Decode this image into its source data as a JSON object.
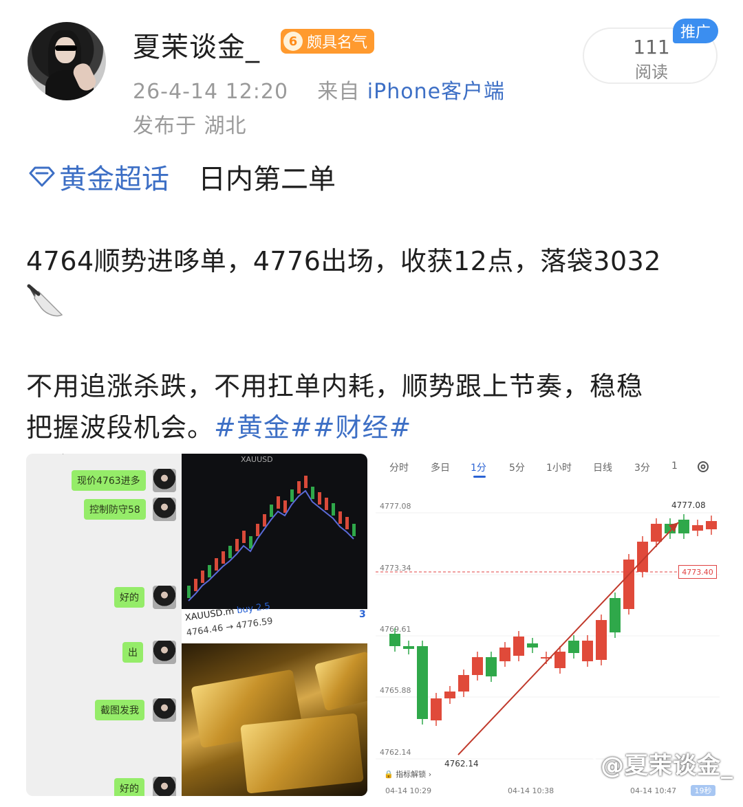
{
  "post": {
    "username": "夏茉谈金_",
    "badge_level": "6",
    "badge_label": "颇具名气",
    "date_time": "26-4-14 12:20",
    "source_prefix": "来自",
    "source": "iPhone客户端",
    "location": "发布于 湖北",
    "read_count": "111",
    "read_label": "阅读",
    "promo_label": "推广"
  },
  "content": {
    "topic": "黄金超话",
    "topic_subtitle": "日内第二单",
    "line1": "4764顺势进哆单，4776出场，收获12点，落袋3032",
    "line2": "不用追涨杀跌，不用扛单内耗，顺势跟上节奏，稳稳",
    "line3_text": "把握波段机会。",
    "hashtags": "#黄金##财经#"
  },
  "left_image": {
    "chat_messages": [
      "现价4763进多",
      "控制防守58",
      "好的",
      "出",
      "截图发我",
      "好的"
    ],
    "trade_symbol": "XAUUSD.m",
    "trade_side": "buy 2.5",
    "trade_prices": "4764.46 → 4776.59",
    "trade_index": "3",
    "chart_symbol": "XAUUSD"
  },
  "right_image": {
    "tabs": [
      "分时",
      "多日",
      "1分",
      "5分",
      "1小时",
      "日线",
      "3分",
      "1"
    ],
    "active_tab": "1分",
    "y_labels": [
      "4777.08",
      "4773.34",
      "4769.61",
      "4765.88",
      "4762.14"
    ],
    "x_labels": [
      "04-14 10:29",
      "04-14 10:38",
      "04-14 10:47"
    ],
    "high_label": "4777.08",
    "low_label": "4762.14",
    "current_price": "4773.40",
    "indicator_label": "指标解锁",
    "seconds_badge": "19秒",
    "colors": {
      "up": "#e04a3a",
      "down": "#2fa84a",
      "line": "#c0392b",
      "active": "#2a63d4"
    }
  },
  "watermark": "@夏茉谈金_"
}
